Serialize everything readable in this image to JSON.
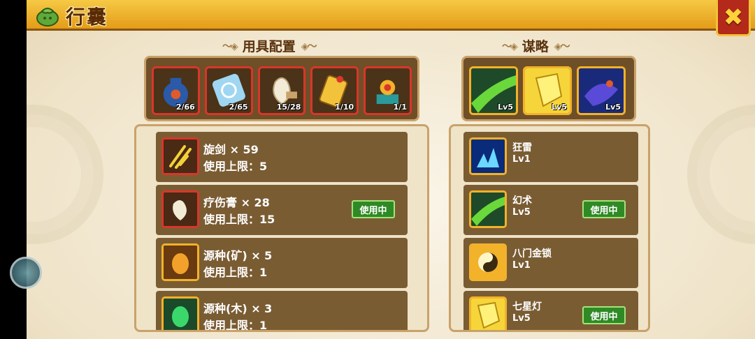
{
  "header": {
    "title": "行囊",
    "close_icon": "close-x-icon"
  },
  "equipment": {
    "section_title": "用具配置",
    "slots": [
      {
        "icon": "vase-bomb-icon",
        "count": "2/66"
      },
      {
        "icon": "scroll-icon",
        "count": "2/65"
      },
      {
        "icon": "ointment-pouch-icon",
        "count": "15/28"
      },
      {
        "icon": "gold-token-icon",
        "count": "1/10"
      },
      {
        "icon": "orb-box-icon",
        "count": "1/1"
      }
    ],
    "items": [
      {
        "name": "旋剑 × 59",
        "limit": "使用上限：5",
        "in_use": ""
      },
      {
        "name": "疗伤膏 × 28",
        "limit": "使用上限：15",
        "in_use": "使用中"
      },
      {
        "name": "源种(矿) × 5",
        "limit": "使用上限：1",
        "in_use": ""
      },
      {
        "name": "源种(木) × 3",
        "limit": "使用上限：1",
        "in_use": ""
      }
    ]
  },
  "strategy": {
    "section_title": "谋略",
    "slots": [
      {
        "icon": "illusion-skill-icon",
        "level": "Lv5"
      },
      {
        "icon": "lantern-skill-icon",
        "level": "Lv5"
      },
      {
        "icon": "dragon-skill-icon",
        "level": "Lv5"
      }
    ],
    "items": [
      {
        "name": "狂雷",
        "level": "Lv1",
        "in_use": ""
      },
      {
        "name": "幻术",
        "level": "Lv5",
        "in_use": "使用中"
      },
      {
        "name": "八门金锁",
        "level": "Lv1",
        "in_use": ""
      },
      {
        "name": "七星灯",
        "level": "Lv5",
        "in_use": "使用中"
      }
    ]
  },
  "colors": {
    "accent": "#e49c18",
    "panel": "#7a5c33",
    "in_use": "#2f8a25",
    "slot_border_red": "#d9362a",
    "slot_border_gold": "#f2b22a"
  }
}
